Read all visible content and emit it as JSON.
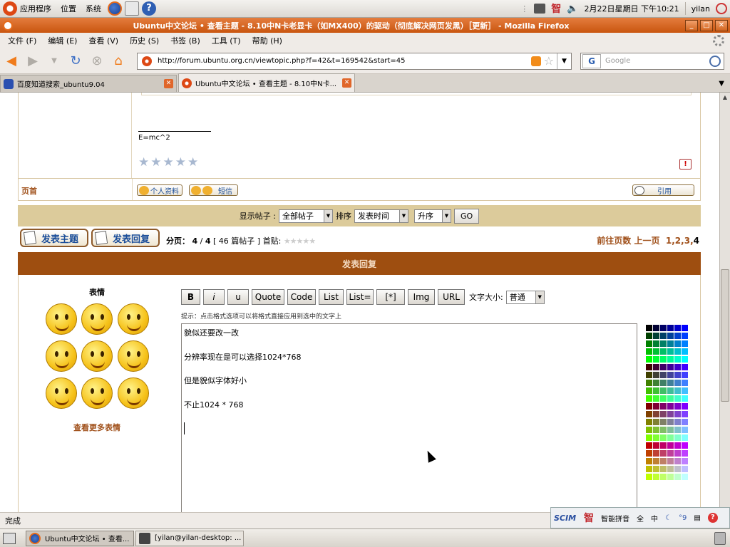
{
  "top_panel": {
    "menus": [
      "应用程序",
      "位置",
      "系统"
    ],
    "clock": "2月22日星期日 下午10:21",
    "user": "yilan",
    "ime_tray": "智"
  },
  "window": {
    "title": "Ubuntu中文论坛 • 查看主题 - 8.10中N卡老显卡（如MX400）的驱动（彻底解决网页发黑）［更新］ - Mozilla Firefox"
  },
  "menubar": [
    "文件 (F)",
    "编辑 (E)",
    "查看 (V)",
    "历史 (S)",
    "书签 (B)",
    "工具 (T)",
    "帮助 (H)"
  ],
  "navbar": {
    "url": "http://forum.ubuntu.org.cn/viewtopic.php?f=42&t=169542&start=45",
    "search_placeholder": "Google",
    "search_engine": "G"
  },
  "tabs": [
    {
      "label": "百度知道搜索_ubuntu9.04",
      "active": false
    },
    {
      "label": "Ubuntu中文论坛 • 查看主题 - 8.10中N卡...",
      "active": true
    }
  ],
  "post": {
    "signature": "E=mc^2",
    "star_count": 5,
    "home_link": "页首",
    "buttons": {
      "profile": "个人资料",
      "pm": "短信",
      "quote": "引用"
    },
    "report_icon_text": "!"
  },
  "filter": {
    "show_label": "显示帖子 :",
    "show_value": "全部帖子",
    "sort_label": "排序",
    "sort_value": "发表时间",
    "order_value": "升序",
    "go": "GO"
  },
  "paging": {
    "new_topic": "发表主题",
    "post_reply": "发表回复",
    "page_label": "分页：",
    "page_current": "4",
    "page_total": "4",
    "posts_count_text": "[ 46 篇帖子 ]",
    "first_post_label": "首贴:",
    "goto_label": "前往页数",
    "prev_label": "上一页",
    "pages": [
      "1",
      "2",
      "3",
      "4"
    ]
  },
  "reply": {
    "header": "发表回复",
    "emote_title": "表情",
    "more_emotes": "查看更多表情",
    "format_buttons": [
      "B",
      "i",
      "u",
      "Quote",
      "Code",
      "List",
      "List=",
      "[*]",
      "Img",
      "URL"
    ],
    "font_size_label": "文字大小:",
    "font_size_value": "普通",
    "hint": "提示：点击格式选项可以将格式直接应用到选中的文字上",
    "lines": [
      "貌似还要改一改",
      "分辨率现在是可以选择1024*768",
      "但是貌似字体好小",
      "不止1024 * 768"
    ]
  },
  "status": {
    "text": "完成"
  },
  "ime": {
    "name": "智能拼音",
    "full": "全",
    "zh": "中",
    "punct": "°9"
  },
  "taskbar": [
    {
      "label": "Ubuntu中文论坛 • 查看...",
      "active": true
    },
    {
      "label": "[yilan@yilan-desktop: ...",
      "active": false
    }
  ],
  "colors": {
    "forum_brown": "#9e4e10",
    "forum_tan": "#dccb9b",
    "link_blue": "#1a4d99",
    "firefox_orange": "#c9550f"
  }
}
